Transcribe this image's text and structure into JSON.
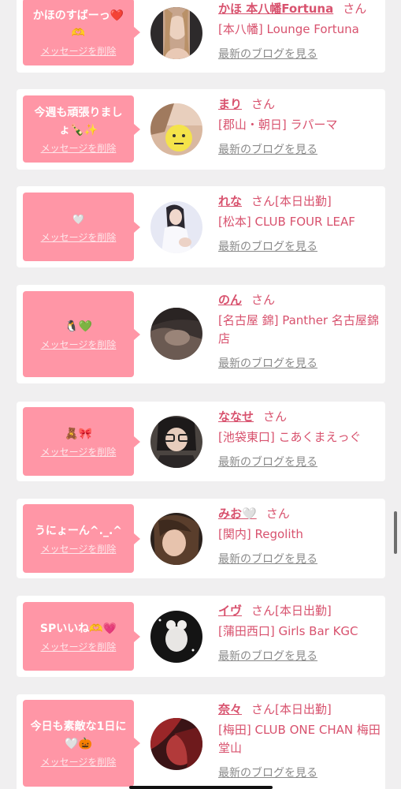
{
  "colors": {
    "accent": "#ff96a6",
    "name": "#d8526e",
    "link_gray": "#8a8a8a",
    "background": "#f0eff0"
  },
  "delete_label": "メッセージを削除",
  "blog_label": "最新のブログを見る",
  "san_label": "さん",
  "items": [
    {
      "message": "かほのすばーっ❤️🫶",
      "name": "かほ 本八幡Fortuna",
      "san": "さん",
      "status": "",
      "shop": "[本八幡] Lounge Fortuna",
      "avatar": "avatar-blonde-woman"
    },
    {
      "message": "今週も頑張りましょ🍾✨",
      "name": "まり",
      "san": "さん",
      "status": "",
      "shop": "[郡山・朝日] ラパーマ",
      "avatar": "avatar-emoji-face"
    },
    {
      "message": "🤍",
      "name": "れな",
      "san": "さん",
      "status": "[本日出勤]",
      "shop": "[松本] CLUB FOUR LEAF",
      "avatar": "avatar-white-dress"
    },
    {
      "message": "🐧💚",
      "name": "のん",
      "san": "さん",
      "status": "",
      "shop": "[名古屋 錦] Panther 名古屋錦店",
      "avatar": "avatar-dim-room"
    },
    {
      "message": "🧸🎀",
      "name": "ななせ",
      "san": "さん",
      "status": "",
      "shop": "[池袋東口] こあくまえっぐ",
      "avatar": "avatar-glasses"
    },
    {
      "message": "うにょーん^._.^",
      "name": "みお🤍",
      "san": "さん",
      "status": "",
      "shop": "[関内] Regolith",
      "avatar": "avatar-dark-hair"
    },
    {
      "message": "SPいいね🫶💗",
      "name": "イヴ",
      "san": "さん",
      "status": "[本日出勤]",
      "shop": "[蒲田西口] Girls Bar KGC",
      "avatar": "avatar-dark-lights"
    },
    {
      "message": "今日も素敵な1日に🤍🎃",
      "name": "奈々",
      "san": "さん",
      "status": "[本日出勤]",
      "shop": "[梅田] CLUB ONE CHAN 梅田堂山",
      "avatar": "avatar-red-hair"
    }
  ]
}
